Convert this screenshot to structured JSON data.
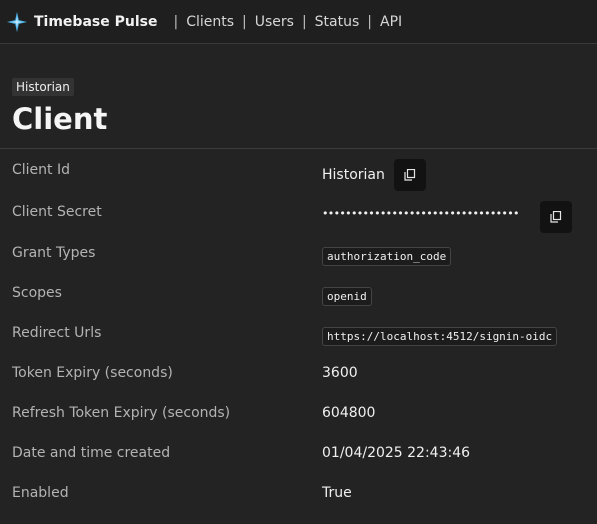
{
  "nav": {
    "brand": "Timebase Pulse",
    "links": [
      "Clients",
      "Users",
      "Status",
      "API"
    ],
    "sep": "|"
  },
  "page": {
    "tag": "Historian",
    "title": "Client"
  },
  "fields": {
    "client_id": {
      "label": "Client Id",
      "value": "Historian"
    },
    "client_secret": {
      "label": "Client Secret",
      "value": "••••••••••••••••••••••••••••••••••"
    },
    "grant_types": {
      "label": "Grant Types",
      "value": "authorization_code"
    },
    "scopes": {
      "label": "Scopes",
      "value": "openid"
    },
    "redirect_urls": {
      "label": "Redirect Urls",
      "value": "https://localhost:4512/signin-oidc"
    },
    "token_expiry": {
      "label": "Token Expiry (seconds)",
      "value": "3600"
    },
    "refresh_expiry": {
      "label": "Refresh Token Expiry (seconds)",
      "value": "604800"
    },
    "created": {
      "label": "Date and time created",
      "value": "01/04/2025 22:43:46"
    },
    "enabled": {
      "label": "Enabled",
      "value": "True"
    }
  },
  "icons": {
    "logo": "star-logo-icon",
    "copy": "copy-icon"
  },
  "colors": {
    "accent": "#4fb3e8",
    "background": "#232323"
  }
}
